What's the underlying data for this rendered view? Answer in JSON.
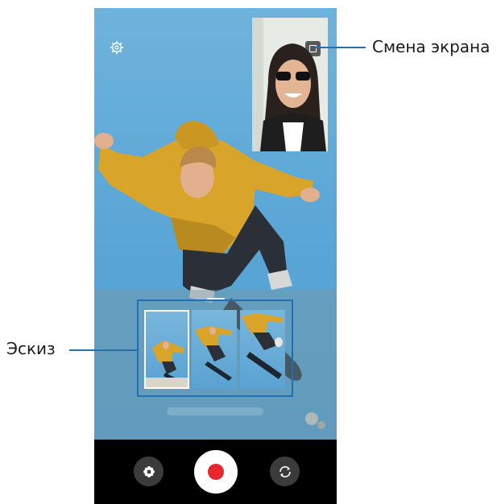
{
  "callouts": {
    "screen_switch": "Смена экрана",
    "thumbnail": "Эскиз"
  },
  "camera": {
    "settings_icon": "gear-icon",
    "swap_icon": "picture-in-picture-icon",
    "filter_icon": "flower-effects-icon",
    "record_icon": "record-dot-icon",
    "switch_icon": "camera-switch-icon",
    "record_color": "#e8262d",
    "accent_color": "#1e6fb6"
  }
}
